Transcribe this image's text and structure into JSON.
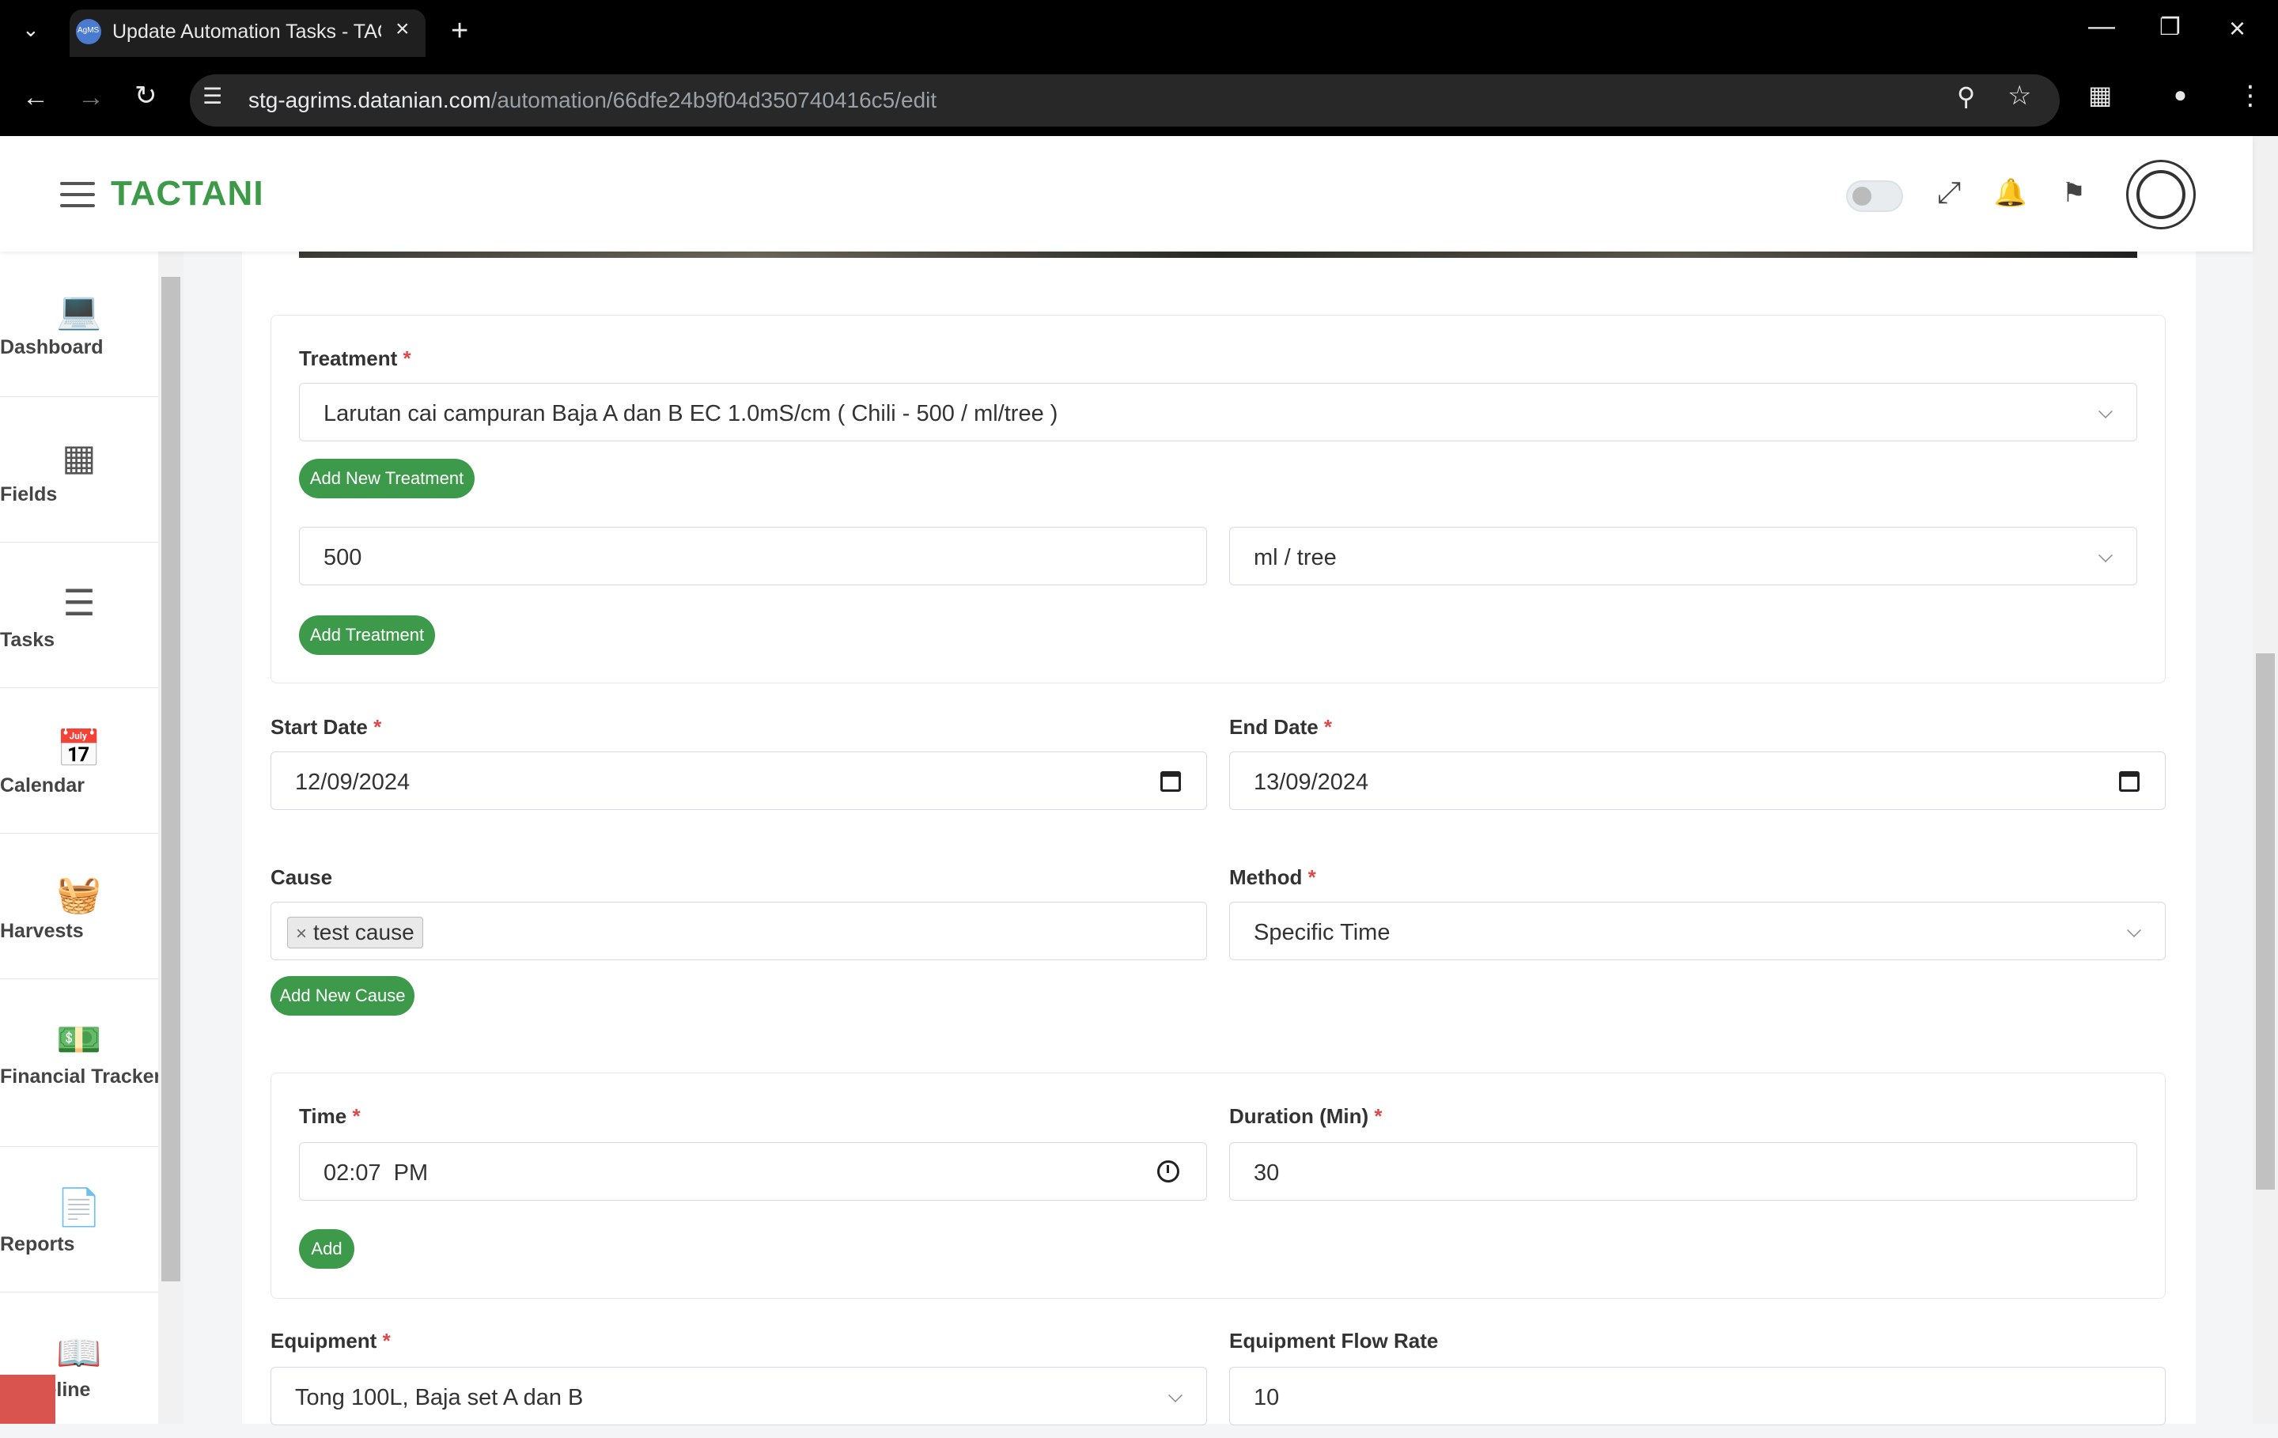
{
  "browser": {
    "tab_title": "Update Automation Tasks - TAC",
    "favicon_text": "AgMS",
    "url_host": "stg-agrims.datanian.com",
    "url_path": "/automation/66dfe24b9f04d350740416c5/edit"
  },
  "app": {
    "brand": "TACTANI"
  },
  "sidebar": {
    "items": [
      {
        "label": "Dashboard",
        "icon": "laptop-icon"
      },
      {
        "label": "Fields",
        "icon": "fields-icon"
      },
      {
        "label": "Tasks",
        "icon": "tasks-icon"
      },
      {
        "label": "Calendar",
        "icon": "calendar-icon"
      },
      {
        "label": "Harvests",
        "icon": "basket-icon"
      },
      {
        "label": "Financial Tracker",
        "icon": "money-icon"
      },
      {
        "label": "Reports",
        "icon": "report-icon"
      },
      {
        "label": "uideline",
        "icon": "book-icon"
      }
    ]
  },
  "form": {
    "treatment_label": "Treatment",
    "treatment_value": "Larutan cai campuran Baja A dan B EC 1.0mS/cm ( Chili - 500 / ml/tree )",
    "add_new_treatment": "Add New Treatment",
    "amount_value": "500",
    "unit_value": "ml / tree",
    "add_treatment": "Add Treatment",
    "start_date_label": "Start Date",
    "start_date_value": "12/09/2024",
    "end_date_label": "End Date",
    "end_date_value": "13/09/2024",
    "cause_label": "Cause",
    "cause_chip": "test cause",
    "add_new_cause": "Add New Cause",
    "method_label": "Method",
    "method_value": "Specific Time",
    "time_label": "Time",
    "time_value": "02:07  PM",
    "duration_label": "Duration (Min)",
    "duration_value": "30",
    "add": "Add",
    "equipment_label": "Equipment",
    "equipment_value": "Tong 100L, Baja set A dan B",
    "flow_rate_label": "Equipment Flow Rate",
    "flow_rate_value": "10",
    "required_mark": "*"
  },
  "colors": {
    "accent": "#3d9a4a",
    "required": "#e04848"
  }
}
